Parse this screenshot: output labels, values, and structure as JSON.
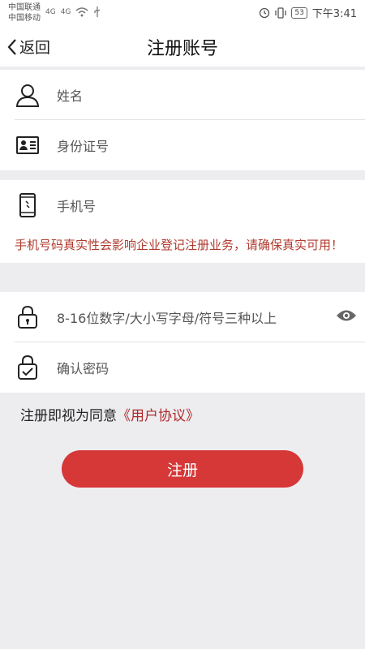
{
  "status_bar": {
    "carrier_1": "中国联通",
    "carrier_2": "中国移动",
    "net_1": "4G",
    "net_2": "4G",
    "battery": "53",
    "time": "下午3:41"
  },
  "nav": {
    "back_label": "返回",
    "title": "注册账号"
  },
  "form": {
    "name_placeholder": "姓名",
    "id_placeholder": "身份证号",
    "phone_placeholder": "手机号",
    "phone_warning": "手机号码真实性会影响企业登记注册业务，请确保真实可用！",
    "password_placeholder": "8-16位数字/大小写字母/符号三种以上",
    "confirm_placeholder": "确认密码"
  },
  "agreement": {
    "prefix": "注册即视为同意",
    "link": "《用户协议》"
  },
  "register_label": "注册",
  "colors": {
    "accent": "#d63737",
    "warning": "#b03a2e",
    "background": "#ededf0"
  },
  "icons": [
    "person-icon",
    "id-card-icon",
    "phone-icon",
    "lock-icon",
    "lock-check-icon",
    "eye-icon",
    "back-chevron-icon"
  ]
}
